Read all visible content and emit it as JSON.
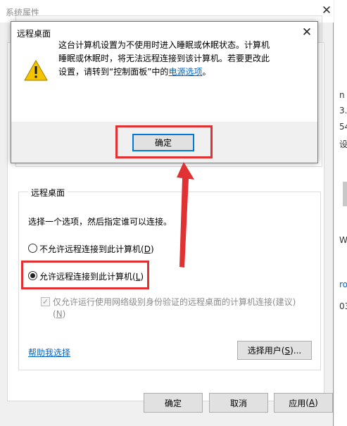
{
  "system_window": {
    "title": "系统属性",
    "close_glyph": "✕"
  },
  "remote_desktop": {
    "group_title": "远程桌面",
    "description": "选择一个选项，然后指定谁可以连接。",
    "options": [
      {
        "label": "不允许远程连接到此计算机",
        "hotkey": "D",
        "checked": false
      },
      {
        "label": "允许远程连接到此计算机",
        "hotkey": "L",
        "checked": true
      }
    ],
    "nla_checkbox": {
      "label_main": "仅允许运行使用网络级别身份验证的远程桌面的计算机连接(建议)",
      "hotkey": "N",
      "checked": true,
      "enabled": false
    },
    "help_link": "帮助我选择",
    "select_users_button": {
      "label": "选择用户",
      "hotkey": "S",
      "suffix": "..."
    }
  },
  "bottom_buttons": {
    "ok": "确定",
    "cancel": "取消",
    "apply": {
      "label": "应用",
      "hotkey": "A"
    }
  },
  "right_edge_fragments": [
    "n",
    "3.",
    "54",
    "设",
    "W",
    "ro",
    "03"
  ],
  "dialog": {
    "title": "远程桌面",
    "close_glyph": "✕",
    "message_before_link": "这台计算机设置为不使用时进入睡眠或休眠状态。计算机睡眠或休眠时，将无法远程连接到该计算机。若要更改此设置，请转到“控制面板”中的",
    "message_link": "电源选项",
    "message_after_link": "。",
    "ok_button": "确定",
    "icon": "warning-icon"
  },
  "colors": {
    "annotation_red": "#e03232",
    "link_blue": "#0066cc",
    "warning_yellow": "#f5c400"
  }
}
